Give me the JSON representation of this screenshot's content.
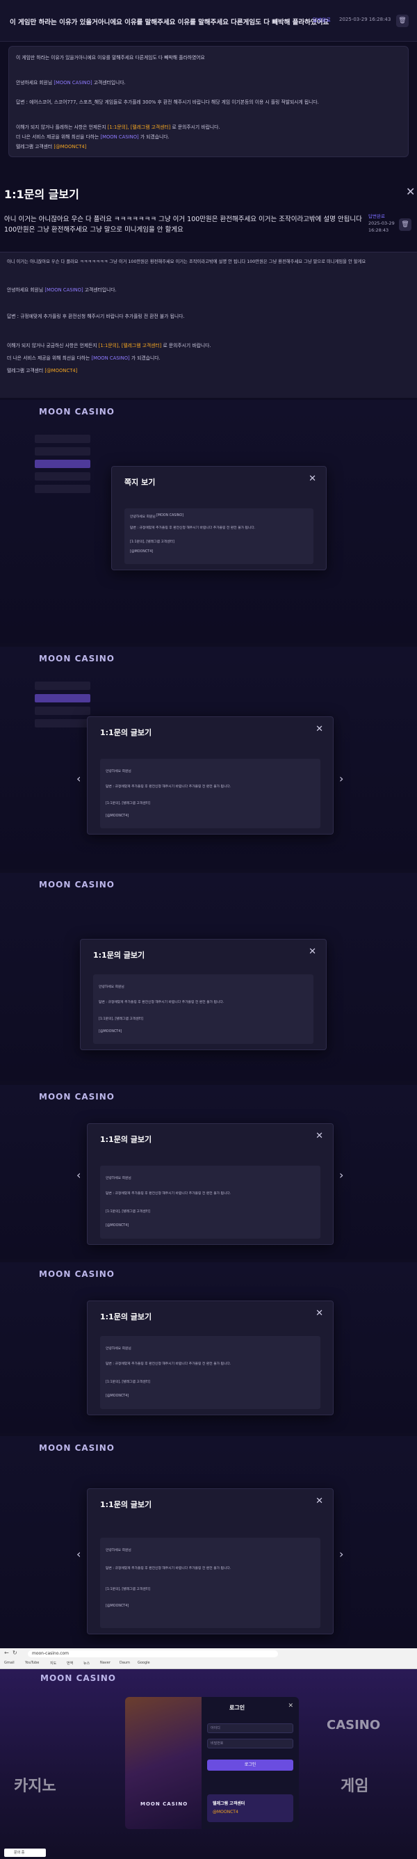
{
  "header": {
    "title": "이 게임만 하라는 이유가 있을거아니에요 이유를 말해주세요 이유를 말해주세요 다른게임도 다 빼박해 플라하였어요",
    "badge": "답변완료",
    "date": "2025-03-29 16:28:43",
    "delete_icon": "trash-icon"
  },
  "notice": {
    "line1": "이 게임만 하라는 이유가 있을거아니에요 이유를 말해주세요 다른게임도 다 빼박해 플라하였어요",
    "greeting": "안녕하세요 회원님",
    "brand": "[MOON CASINO]",
    "greeting_tail": " 고객센터입니다.",
    "answer": "답변 : 에어스코어, 스코어777, 스포츠_해당 게임들로 추가플레 300% 후 환전 해주시기 바랍니다 해당 게임 이기본등의 이용 시 플링 적발되시게 됩니다.",
    "extra1_pre": "이해가 되지 않거나 플레하는 사항은 언제든지 ",
    "extra1_hl": "[1:1문의], [텔레그램 고객센터]",
    "extra1_post": " 로 문의주시기 바랍니다.",
    "extra2_pre": "더 나은 서비스 제공을 위해 최선을 다하는 ",
    "extra2_hl": "[MOON CASINO]",
    "extra2_post": " 가 되겠습니다.",
    "tg_pre": "텔레그램 고객센터 ",
    "tg_hl": "[@MOONCT4]"
  },
  "inquiry": {
    "title": "1:1문의 글보기",
    "question": "아니 이거는 아니잖아요 우슨 다 플러요 ㅋㅋㅋㅋㅋㅋㅋ 그냥 이거 100만원은 환전해주세요 이거는 조작이라고밖에 설명 안됩니다 100만원은 그냥 환전해주세요 그냥 말으로 미니게임을 안 할게요",
    "meta_badge": "답변완료",
    "meta_date": "2025-03-29",
    "meta_time": "16:28:43",
    "answer_q": "아니 이거는 아니잖아요 우슨 다 플러요 ㅋㅋㅋㅋㅋㅋㅋ 그냥 이거 100만원은 환전해주세요 이거는 조작이라고밖에 설명 안 됩니다 100만원은 그냥 환전해주세요 그냥 말으로 미니게임을 안 할게요",
    "greeting": "안녕하세요 회원님",
    "brand": "[MOON CASINO]",
    "greeting_tail": " 고객센터입니다.",
    "answer": "답변 : 규정에맞게 추가플링 후 환전신청 해주시기 바랍니다 추가플링 전 환전 불가 됩니다.",
    "extra1_pre": "이해가 되지 않거나 궁금하신 사항은 언제든지 ",
    "extra1_hl": "[1:1문의], [텔레그램 고객센터]",
    "extra1_post": " 로 문의주시기 바랍니다.",
    "extra2_pre": "더 나은 서비스 제공을 위해 최선을 다하는 ",
    "extra2_hl": "[MOON CASINO]",
    "extra2_post": " 가 되겠습니다.",
    "tg_pre": "텔레그램 고객센터 ",
    "tg_hl": "[@MOONCT4]"
  },
  "shots": {
    "logo": "MOON CASINO",
    "modal1_title": "쪽지 보기",
    "modal2_title": "1:1문의 글보기",
    "modal3_title": "1:1문의 글보기",
    "modal4_title": "1:1문의 글보기",
    "modal5_title": "1:1문의 글보기",
    "modal6_title": "1:1문의 글보기",
    "close": "✕",
    "prev": "‹",
    "next": "›"
  },
  "browser": {
    "url": "moon-casino.com",
    "bookmarks": [
      "Gmail",
      "YouTube",
      "지도",
      "번역",
      "뉴스",
      "Naver",
      "Daum",
      "Google"
    ]
  },
  "site": {
    "logo": "MOON CASINO",
    "login_title": "로그인",
    "id_placeholder": "아이디",
    "pw_placeholder": "비밀번호",
    "login_button": "로그인",
    "promo_title": "텔레그램 고객센터",
    "promo_handle": "@MOONCT4",
    "brand_badge": "MOON CASINO",
    "big_left": "카지노",
    "big_right": "게임",
    "big_casino": "CASINO",
    "taskbar_item": "문의 중"
  },
  "colors": {
    "accent": "#7a6cff",
    "highlight": "#f4a621",
    "background": "#0f0d22"
  }
}
